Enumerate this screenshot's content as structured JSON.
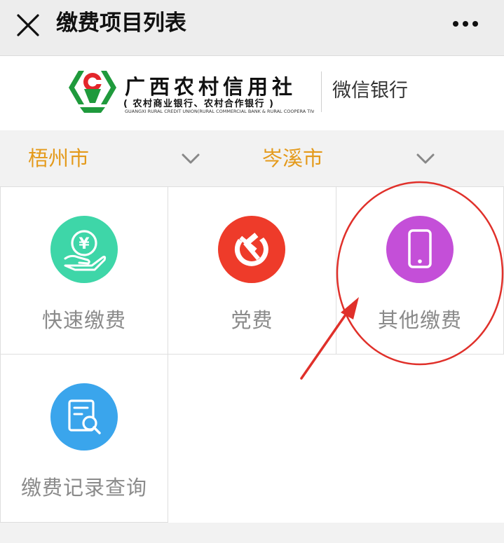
{
  "header": {
    "title": "缴费项目列表",
    "close_icon": "close-icon",
    "more_icon": "more-icon"
  },
  "banner": {
    "bank_name": "广西农村信用社",
    "bank_subtitle": "( 农村商业银行、农村合作银行 )",
    "bank_english": "GUANGXI RURAL CREDIT UNION(RURAL COMMERCIAL BANK & RURAL COOPERA TIVE BANK)",
    "service_name": "微信银行",
    "logo_colors": {
      "green": "#1f9a3c",
      "red": "#e3262b"
    }
  },
  "selectors": {
    "city": "梧州市",
    "county": "岑溪市",
    "text_color": "#e49a1b"
  },
  "tiles": [
    {
      "label": "快速缴费",
      "icon": "yuan-hand-icon",
      "color": "#3ed6a8"
    },
    {
      "label": "党费",
      "icon": "hammer-sickle-icon",
      "color": "#ee3b2a"
    },
    {
      "label": "其他缴费",
      "icon": "phone-icon",
      "color": "#c44fd8"
    },
    {
      "label": "缴费记录查询",
      "icon": "record-search-icon",
      "color": "#3aa5ec"
    }
  ],
  "annotation_color": "#e0302a"
}
